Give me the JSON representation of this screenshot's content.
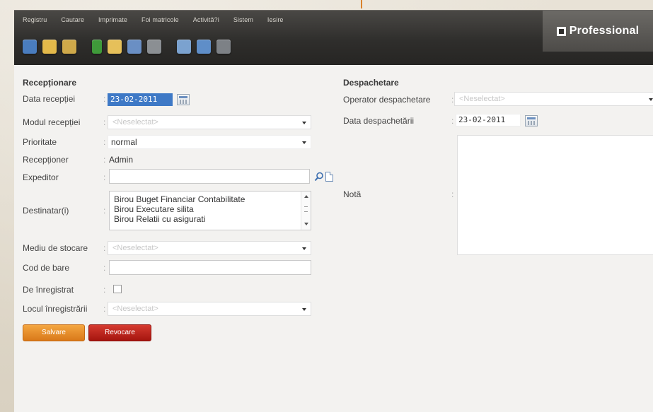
{
  "menu": [
    "Registru",
    "Cautare",
    "Imprimate",
    "Foi matricole",
    "Activită?i",
    "Sistem",
    "Iesire"
  ],
  "logo": {
    "text": "Professional"
  },
  "toolbar_icons": [
    {
      "name": "register-book-icon",
      "color": "#4a7dbf"
    },
    {
      "name": "folder-icon",
      "color": "#e3b94a"
    },
    {
      "name": "folder-documents-icon",
      "color": "#cfa94a"
    },
    {
      "name": "green-book-icon",
      "color": "#3f9a3a"
    },
    {
      "name": "folder-open-icon",
      "color": "#e6c05a"
    },
    {
      "name": "folder-blue-icon",
      "color": "#6a8fc4"
    },
    {
      "name": "archive-icon",
      "color": "#8b8f93"
    },
    {
      "name": "folder-search-icon",
      "color": "#7ba2cf"
    },
    {
      "name": "window-icon",
      "color": "#5f8ec8"
    },
    {
      "name": "stack-icon",
      "color": "#7d8186"
    }
  ],
  "receptionare": {
    "title": "Recepționare",
    "data_receptiei": {
      "label": "Data recepției",
      "value": "23-02-2011"
    },
    "modul_receptiei": {
      "label": "Modul recepției",
      "placeholder": "<Neselectat>"
    },
    "prioritate": {
      "label": "Prioritate",
      "value": "normal"
    },
    "receptioner": {
      "label": "Recepționer",
      "value": "Admin"
    },
    "expeditor": {
      "label": "Expeditor",
      "value": ""
    },
    "destinatari": {
      "label": "Destinatar(i)",
      "items": [
        "Birou Buget Financiar Contabilitate",
        "Birou Executare silita",
        "Birou Relatii cu asigurati"
      ]
    },
    "mediu_stocare": {
      "label": "Mediu de stocare",
      "placeholder": "<Neselectat>"
    },
    "cod_bare": {
      "label": "Cod de bare",
      "value": ""
    },
    "de_inregistrat": {
      "label": "De înregistrat",
      "checked": false
    },
    "locul_inregistrarii": {
      "label": "Locul înregistrării",
      "placeholder": "<Neselectat>"
    }
  },
  "despachetare": {
    "title": "Despachetare",
    "operator": {
      "label": "Operator despachetare",
      "placeholder": "<Neselectat>"
    },
    "data": {
      "label": "Data despachetării",
      "value": "23-02-2011"
    },
    "nota": {
      "label": "Notă",
      "value": ""
    }
  },
  "buttons": {
    "save": "Salvare",
    "cancel": "Revocare"
  },
  "colors": {
    "save": "#e88a25",
    "cancel": "#b91c14",
    "selection": "#3e79c6",
    "topbar": "#2f2e2c"
  }
}
